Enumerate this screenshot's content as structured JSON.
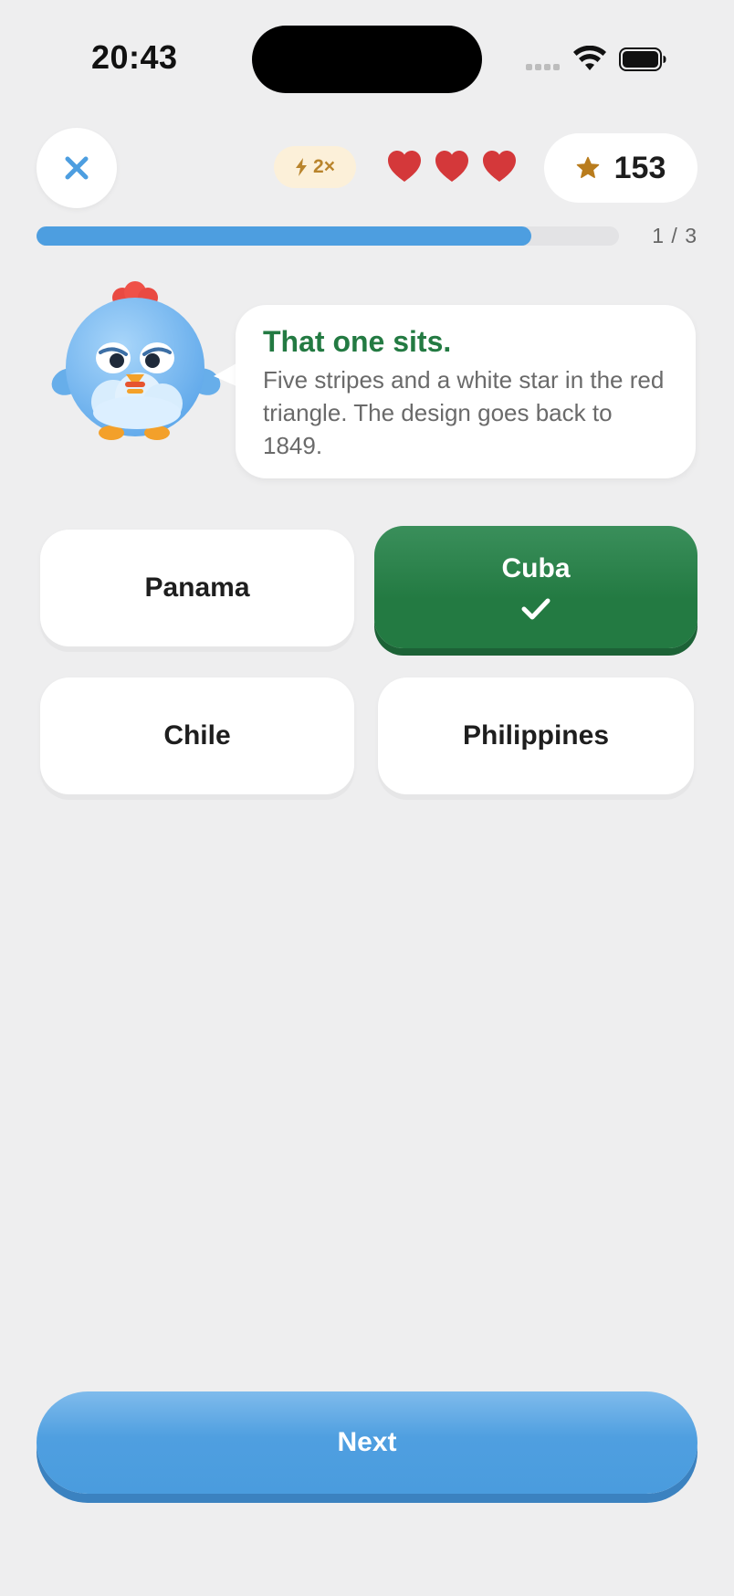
{
  "status_bar": {
    "time": "20:43"
  },
  "header": {
    "boost_label": "2×",
    "lives": 3,
    "score": "153"
  },
  "progress": {
    "label": "1 / 3",
    "fraction": 0.85
  },
  "feedback": {
    "title": "That one sits.",
    "body": "Five stripes and a white star in the red triangle. The design goes back to 1849."
  },
  "answers": [
    {
      "label": "Panama",
      "state": "default"
    },
    {
      "label": "Cuba",
      "state": "correct"
    },
    {
      "label": "Chile",
      "state": "default"
    },
    {
      "label": "Philippines",
      "state": "default"
    }
  ],
  "next_label": "Next",
  "colors": {
    "accent_blue": "#4d9ee0",
    "correct_green": "#237a42",
    "heart_red": "#d4383a",
    "star_gold": "#b97c1d"
  },
  "icons": [
    "close-icon",
    "lightning-icon",
    "heart-icon",
    "star-icon",
    "check-icon",
    "wifi-icon",
    "battery-icon"
  ]
}
